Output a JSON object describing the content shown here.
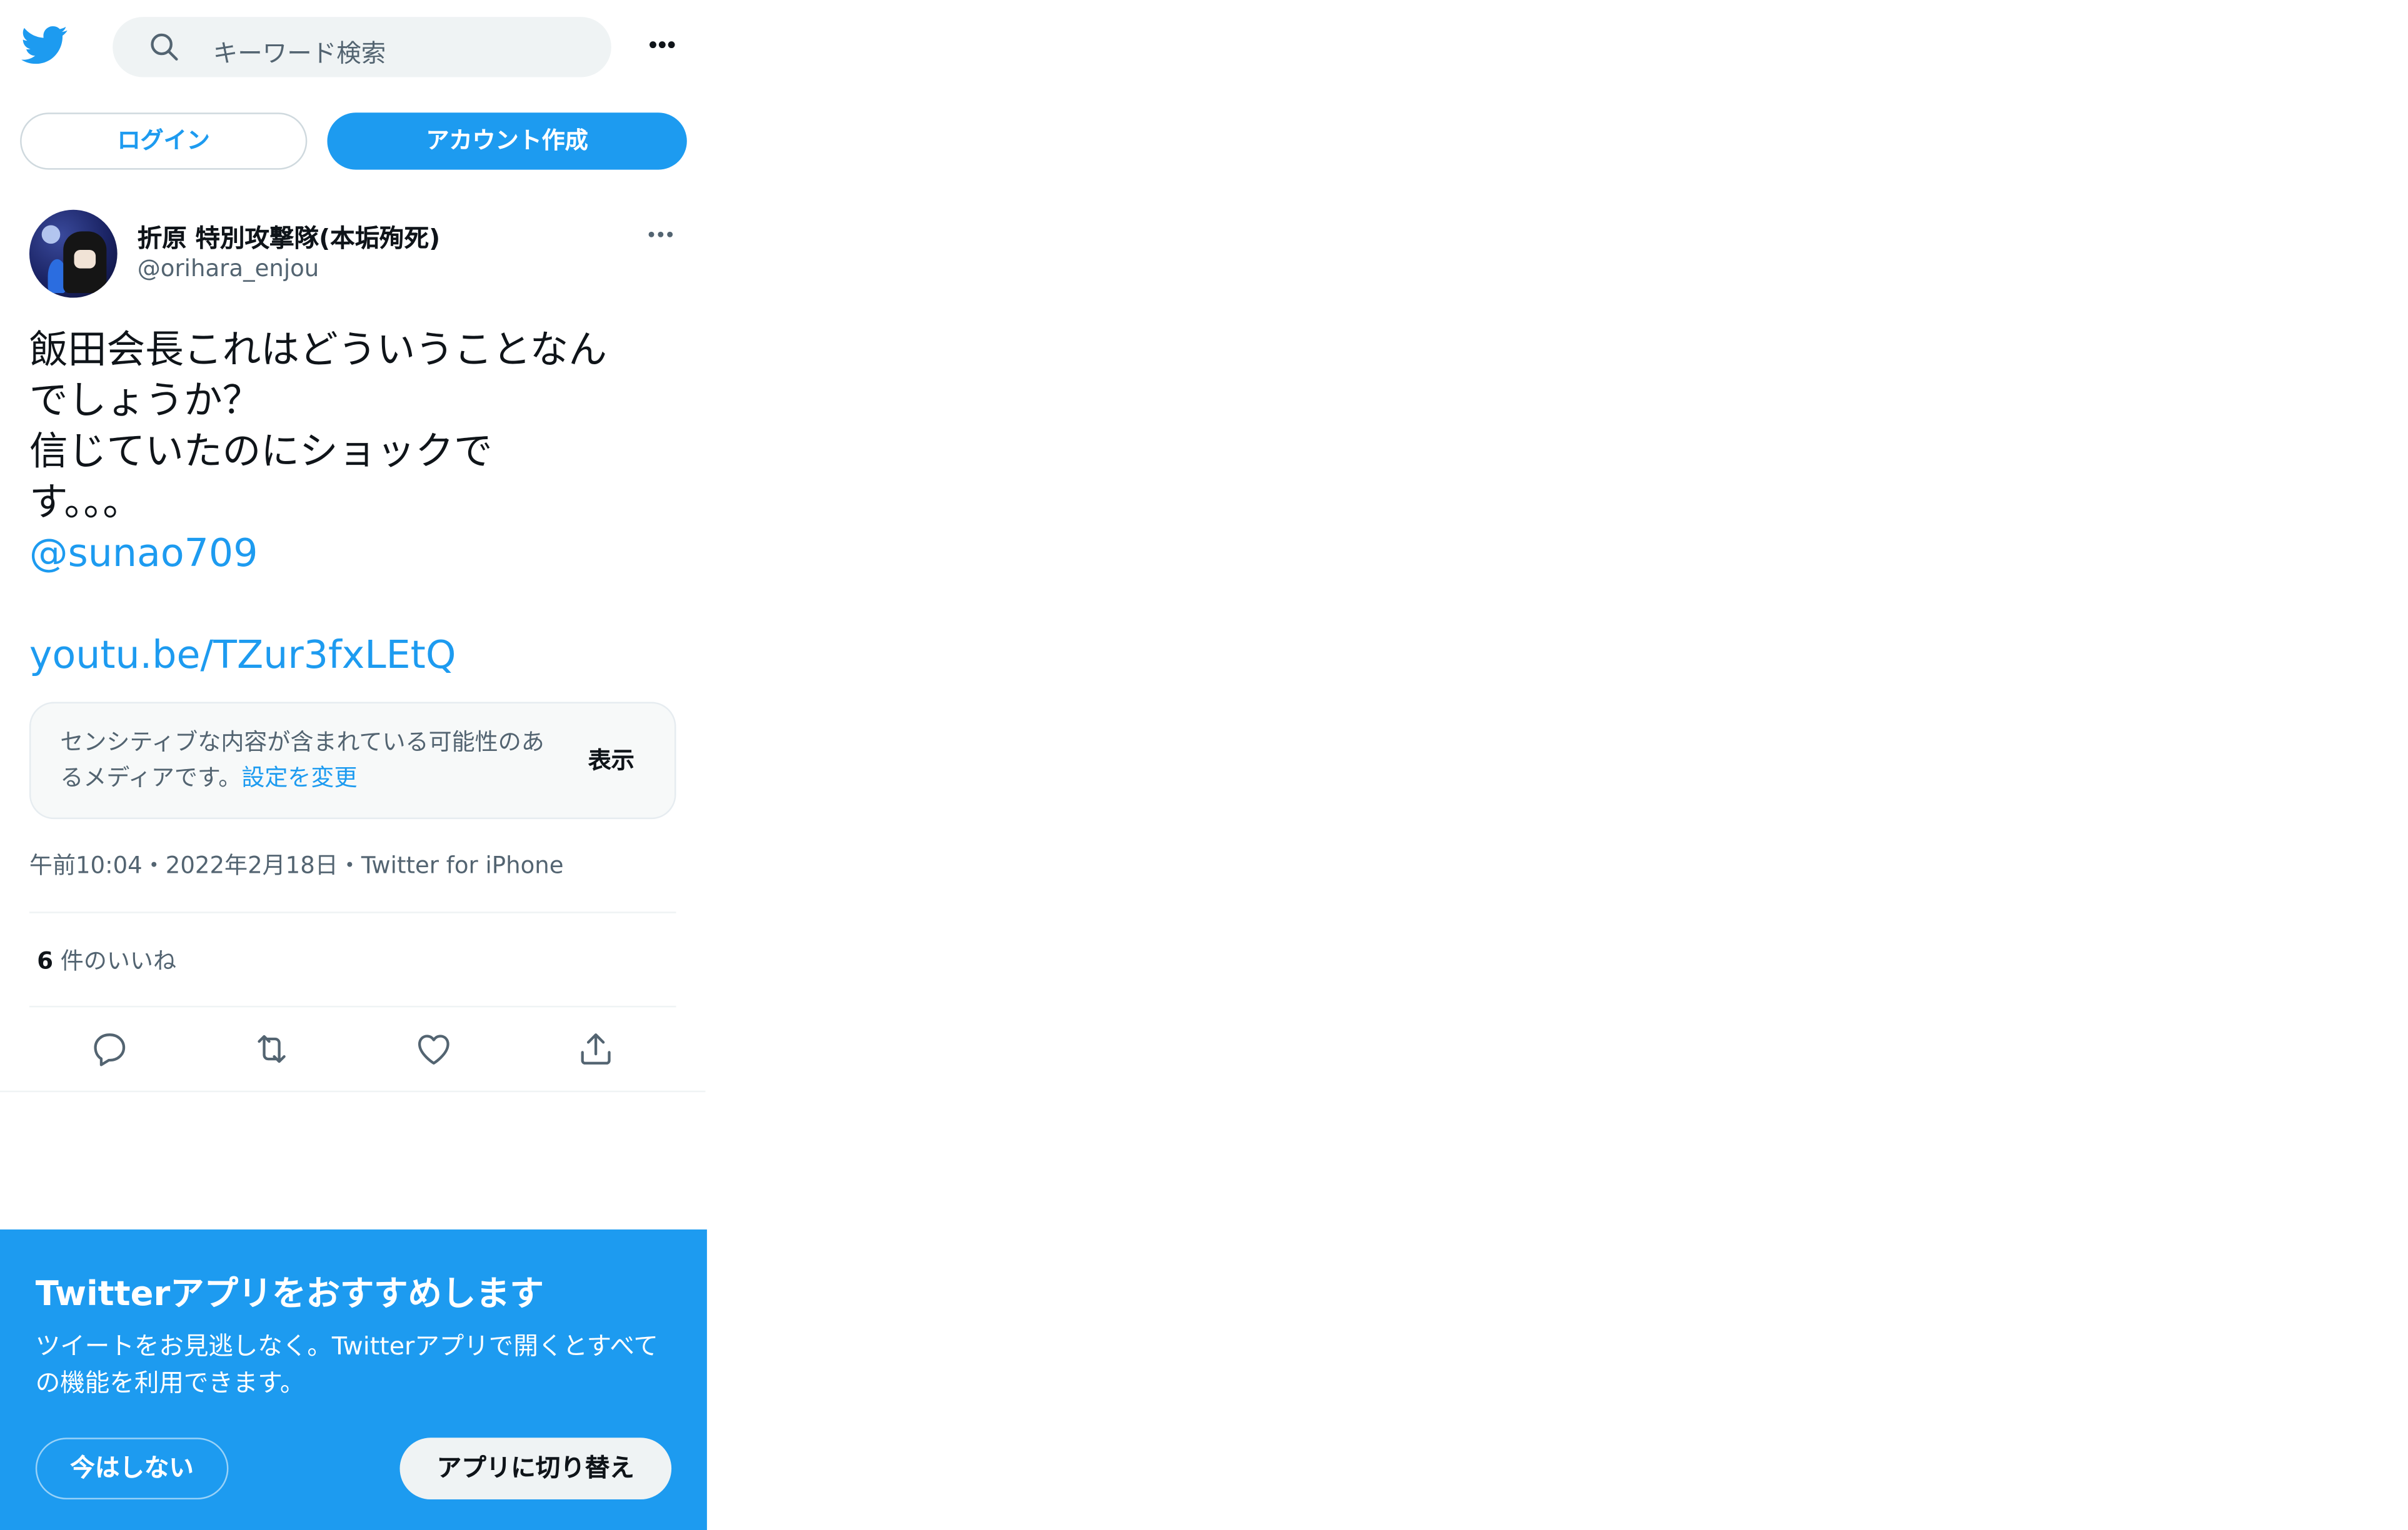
{
  "header": {
    "search_placeholder": "キーワード検索"
  },
  "auth": {
    "login_label": "ログイン",
    "signup_label": "アカウント作成"
  },
  "tweet": {
    "display_name": "折原 特別攻撃隊(本垢殉死)",
    "handle": "@orihara_enjou",
    "text": "飯田会長これはどういうことなん\nでしょうか？\n信じていたのにショックで\nす。。。",
    "mention": "@sunao709",
    "link": "youtu.be/TZur3fxLEtQ",
    "sensitive": {
      "message": "センシティブな内容が含まれている可能性のあるメディアです。",
      "settings_link": "設定を変更",
      "show_label": "表示"
    },
    "meta": "午前10:04・2022年2月18日・Twitter for iPhone",
    "likes_count": "6",
    "likes_label": " 件のいいね"
  },
  "icons": {
    "logo": "twitter-bird-icon",
    "search": "search-icon",
    "more": "more-horizontal-icon",
    "reply": "reply-icon",
    "retweet": "retweet-icon",
    "like": "heart-icon",
    "share": "share-icon"
  },
  "app_banner": {
    "title": "Twitterアプリをおすすめします",
    "description": "ツイートをお見逃しなく。Twitterアプリで開くとすべての機能を利用できます。",
    "not_now_label": "今はしない",
    "switch_label": "アプリに切り替え"
  },
  "colors": {
    "brand": "#1d9bf0",
    "secondary_text": "#536471"
  }
}
